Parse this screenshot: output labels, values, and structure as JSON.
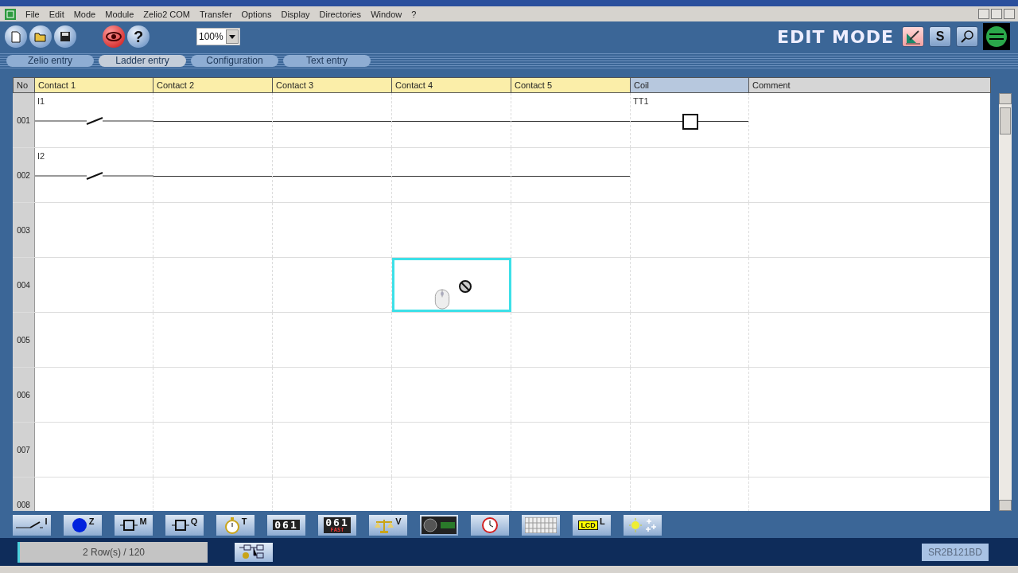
{
  "menu": [
    "File",
    "Edit",
    "Mode",
    "Module",
    "Zelio2 COM",
    "Transfer",
    "Options",
    "Display",
    "Directories",
    "Window",
    "?"
  ],
  "toolbar": {
    "help": "?",
    "zoom": "100%",
    "mode": "EDIT MODE",
    "mode_buttons": [
      {
        "kind": "edit",
        "selected": true
      },
      {
        "kind": "simulate",
        "text": "S",
        "selected": false
      },
      {
        "kind": "monitor",
        "selected": false
      }
    ]
  },
  "tabs": [
    {
      "label": "Zelio entry",
      "selected": false
    },
    {
      "label": "Ladder entry",
      "selected": true
    },
    {
      "label": "Configuration",
      "selected": false
    },
    {
      "label": "Text entry",
      "selected": false
    }
  ],
  "columns": [
    {
      "label": "No",
      "selected": false
    },
    {
      "label": "Contact 1",
      "selected": false
    },
    {
      "label": "Contact 2",
      "selected": false
    },
    {
      "label": "Contact 3",
      "selected": false
    },
    {
      "label": "Contact 4",
      "selected": false
    },
    {
      "label": "Contact 5",
      "selected": false
    },
    {
      "label": "Coil",
      "selected": true
    },
    {
      "label": "Comment",
      "selected": false
    }
  ],
  "rows": [
    {
      "no": "001",
      "cells": [
        {
          "kind": "contact",
          "label": "I1",
          "selected": false
        },
        {
          "kind": "wire",
          "selected": false
        },
        {
          "kind": "wire",
          "selected": false
        },
        {
          "kind": "wire",
          "selected": false
        },
        {
          "kind": "wire",
          "selected": false
        },
        {
          "kind": "coil",
          "label": "TT1",
          "selected": false
        }
      ]
    },
    {
      "no": "002",
      "cells": [
        {
          "kind": "contact",
          "label": "I2",
          "selected": false
        },
        {
          "kind": "wire",
          "selected": false
        },
        {
          "kind": "wire",
          "selected": false
        },
        {
          "kind": "wire",
          "selected": false
        },
        {
          "kind": "wire",
          "selected": false
        },
        {
          "kind": "empty",
          "selected": false
        }
      ]
    },
    {
      "no": "003",
      "cells": [
        {
          "kind": "empty",
          "selected": false
        },
        {
          "kind": "empty",
          "selected": false
        },
        {
          "kind": "empty",
          "selected": false
        },
        {
          "kind": "empty",
          "selected": false
        },
        {
          "kind": "empty",
          "selected": false
        },
        {
          "kind": "empty",
          "selected": false
        }
      ]
    },
    {
      "no": "004",
      "cells": [
        {
          "kind": "empty",
          "selected": false
        },
        {
          "kind": "empty",
          "selected": false
        },
        {
          "kind": "empty",
          "selected": false
        },
        {
          "kind": "empty",
          "selected": true
        },
        {
          "kind": "empty",
          "selected": false
        },
        {
          "kind": "empty",
          "selected": false
        }
      ]
    },
    {
      "no": "005",
      "cells": [
        {
          "kind": "empty",
          "selected": false
        },
        {
          "kind": "empty",
          "selected": false
        },
        {
          "kind": "empty",
          "selected": false
        },
        {
          "kind": "empty",
          "selected": false
        },
        {
          "kind": "empty",
          "selected": false
        },
        {
          "kind": "empty",
          "selected": false
        }
      ]
    },
    {
      "no": "006",
      "cells": [
        {
          "kind": "empty",
          "selected": false
        },
        {
          "kind": "empty",
          "selected": false
        },
        {
          "kind": "empty",
          "selected": false
        },
        {
          "kind": "empty",
          "selected": false
        },
        {
          "kind": "empty",
          "selected": false
        },
        {
          "kind": "empty",
          "selected": false
        }
      ]
    },
    {
      "no": "007",
      "cells": [
        {
          "kind": "empty",
          "selected": false
        },
        {
          "kind": "empty",
          "selected": false
        },
        {
          "kind": "empty",
          "selected": false
        },
        {
          "kind": "empty",
          "selected": false
        },
        {
          "kind": "empty",
          "selected": false
        },
        {
          "kind": "empty",
          "selected": false
        }
      ]
    },
    {
      "no": "008",
      "cells": [
        {
          "kind": "empty",
          "selected": false
        },
        {
          "kind": "empty",
          "selected": false
        },
        {
          "kind": "empty",
          "selected": false
        },
        {
          "kind": "empty",
          "selected": false
        },
        {
          "kind": "empty",
          "selected": false
        },
        {
          "kind": "empty",
          "selected": false
        }
      ]
    }
  ],
  "palette": [
    {
      "kind": "contact",
      "letter": "I"
    },
    {
      "kind": "dot",
      "letter": "Z"
    },
    {
      "kind": "relay",
      "letter": "M"
    },
    {
      "kind": "relay",
      "letter": "Q"
    },
    {
      "kind": "timer",
      "letter": "T"
    },
    {
      "kind": "counter",
      "text": "061"
    },
    {
      "kind": "fastcounter",
      "text": "061",
      "sub": "FAST"
    },
    {
      "kind": "scale",
      "letter": "V"
    },
    {
      "kind": "knob"
    },
    {
      "kind": "clock"
    },
    {
      "kind": "grid"
    },
    {
      "kind": "lcd",
      "text": "LCD",
      "letter": "L"
    },
    {
      "kind": "sun"
    }
  ],
  "status": {
    "rows": "2 Row(s) / 120",
    "module": "SR2B121BD"
  }
}
